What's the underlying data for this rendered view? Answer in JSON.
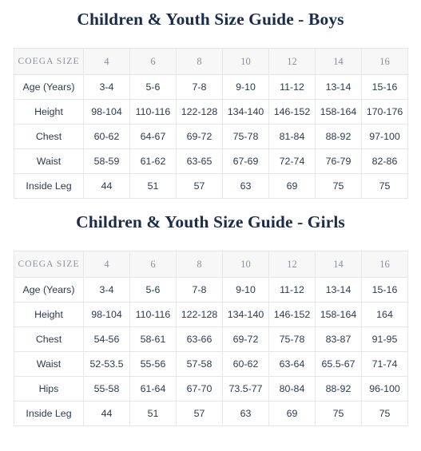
{
  "colors": {
    "title": "#1b2b4b",
    "header_text": "#8d9199",
    "header_bg": "#f7f7f8",
    "border": "#e6e7e9",
    "cell_text": "#2c3a52",
    "page_bg": "#ffffff"
  },
  "tables": [
    {
      "id": "boys",
      "title": "Children & Youth Size Guide - Boys",
      "header": {
        "label": "COEGA SIZE",
        "sizes": [
          "4",
          "6",
          "8",
          "10",
          "12",
          "14",
          "16"
        ]
      },
      "rows": [
        {
          "label": "Age (Years)",
          "values": [
            "3-4",
            "5-6",
            "7-8",
            "9-10",
            "11-12",
            "13-14",
            "15-16"
          ]
        },
        {
          "label": "Height",
          "values": [
            "98-104",
            "110-116",
            "122-128",
            "134-140",
            "146-152",
            "158-164",
            "170-176"
          ]
        },
        {
          "label": "Chest",
          "values": [
            "60-62",
            "64-67",
            "69-72",
            "75-78",
            "81-84",
            "88-92",
            "97-100"
          ]
        },
        {
          "label": "Waist",
          "values": [
            "58-59",
            "61-62",
            "63-65",
            "67-69",
            "72-74",
            "76-79",
            "82-86"
          ]
        },
        {
          "label": "Inside Leg",
          "values": [
            "44",
            "51",
            "57",
            "63",
            "69",
            "75",
            "75"
          ]
        }
      ]
    },
    {
      "id": "girls",
      "title": "Children & Youth Size Guide - Girls",
      "header": {
        "label": "COEGA SIZE",
        "sizes": [
          "4",
          "6",
          "8",
          "10",
          "12",
          "14",
          "16"
        ]
      },
      "rows": [
        {
          "label": "Age (Years)",
          "values": [
            "3-4",
            "5-6",
            "7-8",
            "9-10",
            "11-12",
            "13-14",
            "15-16"
          ]
        },
        {
          "label": "Height",
          "values": [
            "98-104",
            "110-116",
            "122-128",
            "134-140",
            "146-152",
            "158-164",
            "164"
          ]
        },
        {
          "label": "Chest",
          "values": [
            "54-56",
            "58-61",
            "63-66",
            "69-72",
            "75-78",
            "83-87",
            "91-95"
          ]
        },
        {
          "label": "Waist",
          "values": [
            "52-53.5",
            "55-56",
            "57-58",
            "60-62",
            "63-64",
            "65.5-67",
            "71-74"
          ]
        },
        {
          "label": "Hips",
          "values": [
            "55-58",
            "61-64",
            "67-70",
            "73.5-77",
            "80-84",
            "88-92",
            "96-100"
          ]
        },
        {
          "label": "Inside Leg",
          "values": [
            "44",
            "51",
            "57",
            "63",
            "69",
            "75",
            "75"
          ]
        }
      ]
    }
  ]
}
